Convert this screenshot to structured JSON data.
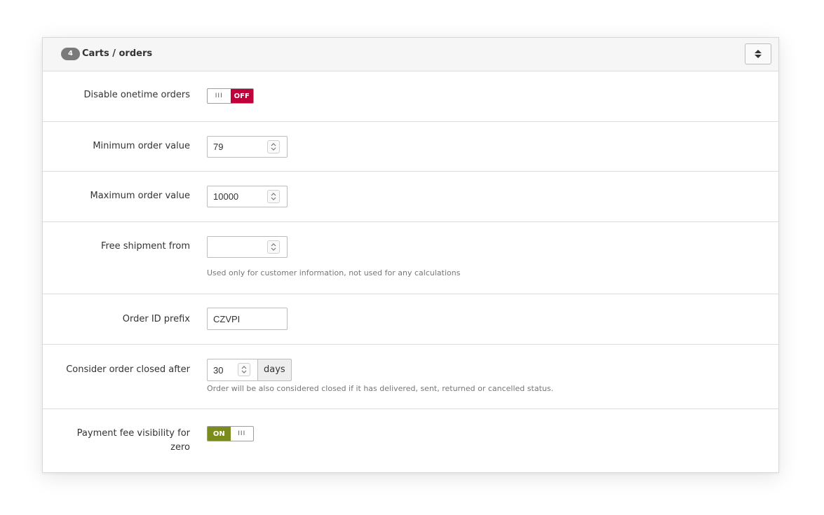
{
  "panel": {
    "badge": "4",
    "title": "Carts / orders"
  },
  "fields": {
    "disable_onetime": {
      "label": "Disable onetime orders",
      "state": "OFF",
      "grip": "III"
    },
    "min_order": {
      "label": "Minimum order value",
      "value": "79"
    },
    "max_order": {
      "label": "Maximum order value",
      "value": "10000"
    },
    "free_shipment": {
      "label": "Free shipment from",
      "value": "",
      "help": "Used only for customer information, not used for any calculations"
    },
    "order_prefix": {
      "label": "Order ID prefix",
      "value": "CZVPI"
    },
    "closed_after": {
      "label": "Consider order closed after",
      "value": "30",
      "unit": "days",
      "help": "Order will be also considered closed if it has delivered, sent, returned or cancelled status."
    },
    "payment_fee": {
      "label_line1": "Payment fee visibility for",
      "label_line2": "zero",
      "state": "ON",
      "grip": "III"
    }
  },
  "colors": {
    "off": "#c0003a",
    "on": "#7c8c1c",
    "badge": "#7a7a7a"
  }
}
